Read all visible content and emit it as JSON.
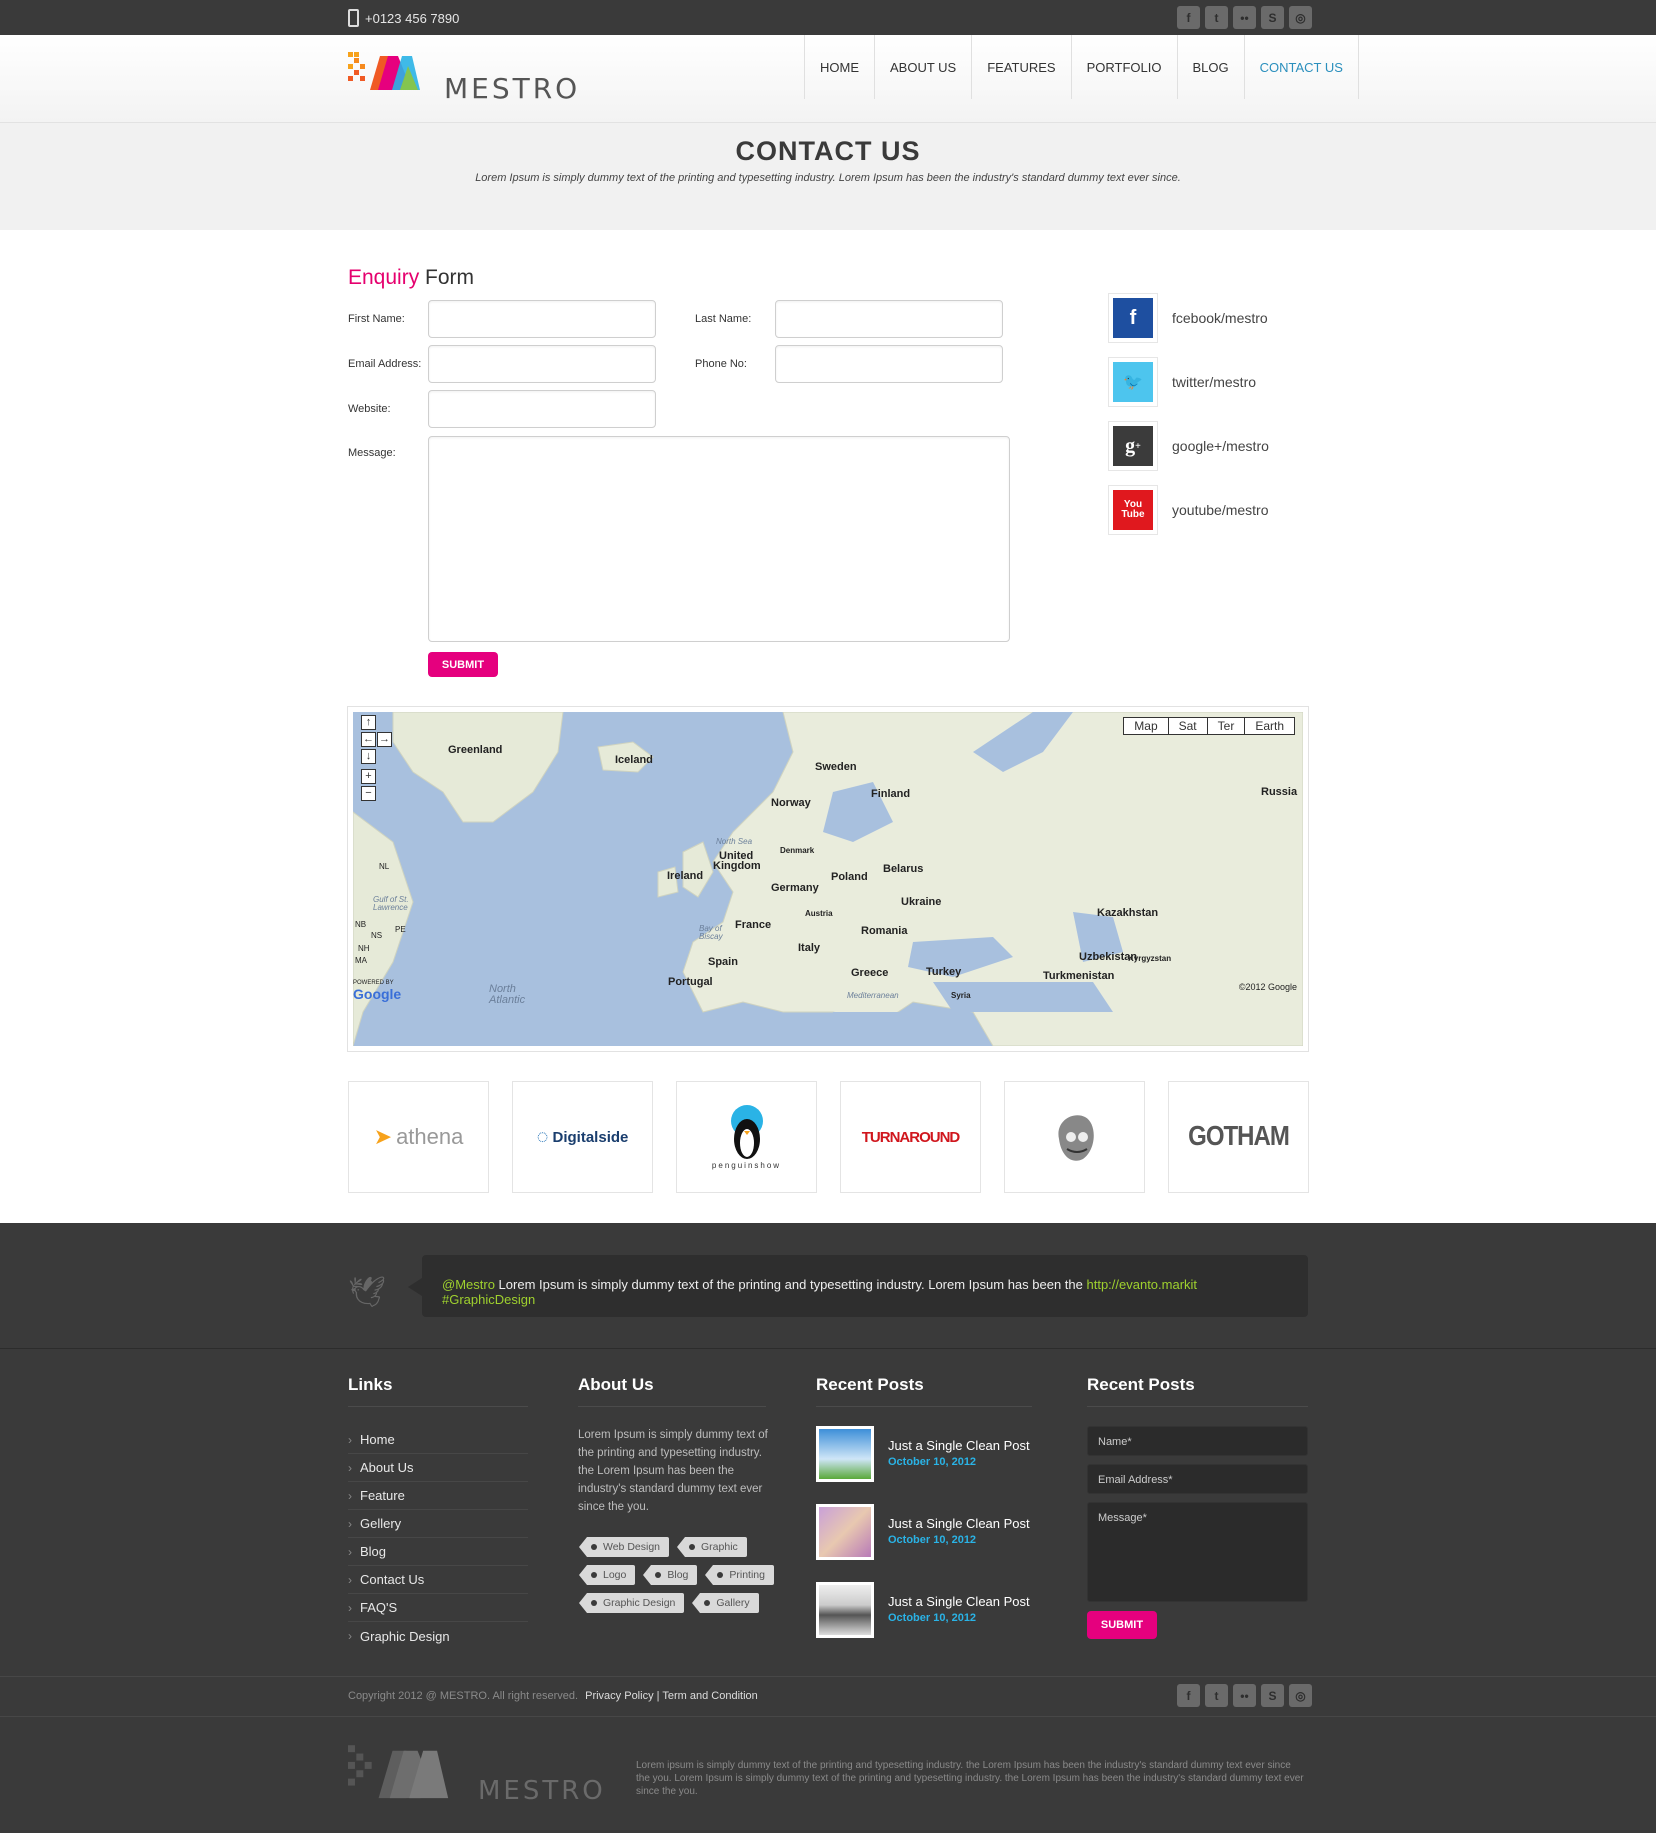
{
  "topbar": {
    "phone": "+0123 456 7890",
    "socials": [
      "facebook-icon",
      "twitter-icon",
      "flickr-icon",
      "skype-icon",
      "dribbble-icon"
    ]
  },
  "brand": {
    "name": "MESTRO"
  },
  "nav": {
    "items": [
      "HOME",
      "ABOUT US",
      "FEATURES",
      "PORTFOLIO",
      "BLOG",
      "CONTACT US"
    ],
    "active": "CONTACT US",
    "active_color": "#2a8fbd"
  },
  "page": {
    "title": "CONTACT US",
    "subtitle": "Lorem Ipsum is simply dummy text of the printing and typesetting industry. Lorem Ipsum has been the industry's standard dummy text ever since."
  },
  "form": {
    "title_accent": "Enquiry",
    "title_rest": " Form",
    "first_name": "First Name:",
    "last_name": "Last Name:",
    "email": "Email Address:",
    "phone": "Phone No:",
    "website": "Website:",
    "message": "Message:",
    "submit": "SUBMIT",
    "accent_color": "#e5007e"
  },
  "contacts": [
    {
      "label": "fcebook/mestro",
      "icon": "facebook-icon",
      "color": "#1e4fa0"
    },
    {
      "label": "twitter/mestro",
      "icon": "twitter-icon",
      "color": "#4dc5ee"
    },
    {
      "label": "google+/mestro",
      "icon": "google-plus-icon",
      "color": "#3b3b3b"
    },
    {
      "label": "youtube/mestro",
      "icon": "youtube-icon",
      "color": "#e0181e"
    }
  ],
  "map": {
    "types": [
      "Map",
      "Sat",
      "Ter",
      "Earth"
    ],
    "copyright": "©2012 Google",
    "labels": [
      "Greenland",
      "Iceland",
      "Sweden",
      "Finland",
      "Norway",
      "Russia",
      "North Sea",
      "United",
      "Kingdom",
      "Denmark",
      "Ireland",
      "Belarus",
      "Poland",
      "Germany",
      "Ukraine",
      "Austria",
      "France",
      "Bay of",
      "Biscay",
      "Romania",
      "Kazakhstan",
      "Italy",
      "Uzbekistan",
      "Kyrgyzstan",
      "Spain",
      "Greece",
      "Turkey",
      "Turkmenistan",
      "Portugal",
      "Syria",
      "Mediterranean",
      "North",
      "Atlantic",
      "NL",
      "Gulf of St.",
      "Lawrence",
      "NB",
      "PE",
      "NS",
      "NH",
      "MA",
      "POWERED BY",
      "Google"
    ]
  },
  "clients": [
    "athena",
    "Digitalside",
    "penguinshow",
    "TURNAROUND",
    "mascot",
    "GOTHAM"
  ],
  "tweet": {
    "handle": "@Mestro",
    "text": " Lorem Ipsum is simply dummy text of the printing and typesetting industry. Lorem Ipsum has been the ",
    "link": "http://evanto.markit",
    "hashtag": " #GraphicDesign"
  },
  "footer": {
    "links_title": "Links",
    "links": [
      "Home",
      "About Us",
      "Feature",
      "Gellery",
      "Blog",
      "Contact Us",
      "FAQ'S",
      "Graphic Design"
    ],
    "about_title": "About Us",
    "about_text": "Lorem Ipsum is simply dummy text of the printing and typesetting industry. the Lorem Ipsum has been the industry's standard dummy text ever since the you.",
    "tags": [
      [
        "Web Design",
        "Graphic"
      ],
      [
        "Logo",
        "Blog",
        "Printing"
      ],
      [
        "Graphic Design",
        "Gallery"
      ]
    ],
    "posts_title": "Recent Posts",
    "posts": [
      {
        "title": "Just a Single Clean Post",
        "date": "October 10, 2012"
      },
      {
        "title": "Just a Single Clean Post",
        "date": "October 10, 2012"
      },
      {
        "title": "Just a Single Clean Post",
        "date": "October 10, 2012"
      }
    ],
    "form_title": "Recent Posts",
    "name_ph": "Name*",
    "email_ph": "Email Address*",
    "message_ph": "Message*",
    "submit": "SUBMIT"
  },
  "copyright": {
    "text": "Copyright 2012 @ MESTRO. All right reserved.",
    "privacy": "Privacy Policy",
    "sep": " | ",
    "terms": "Term and Condition"
  },
  "bottom": {
    "text": "Lorem ipsum is simply dummy text of the printing and typesetting industry. the Lorem Ipsum has been the industry's standard dummy text ever since the you. Lorem Ipsum is simply dummy text of the printing and typesetting industry. the Lorem Ipsum has been the industry's standard dummy text ever since the you."
  }
}
